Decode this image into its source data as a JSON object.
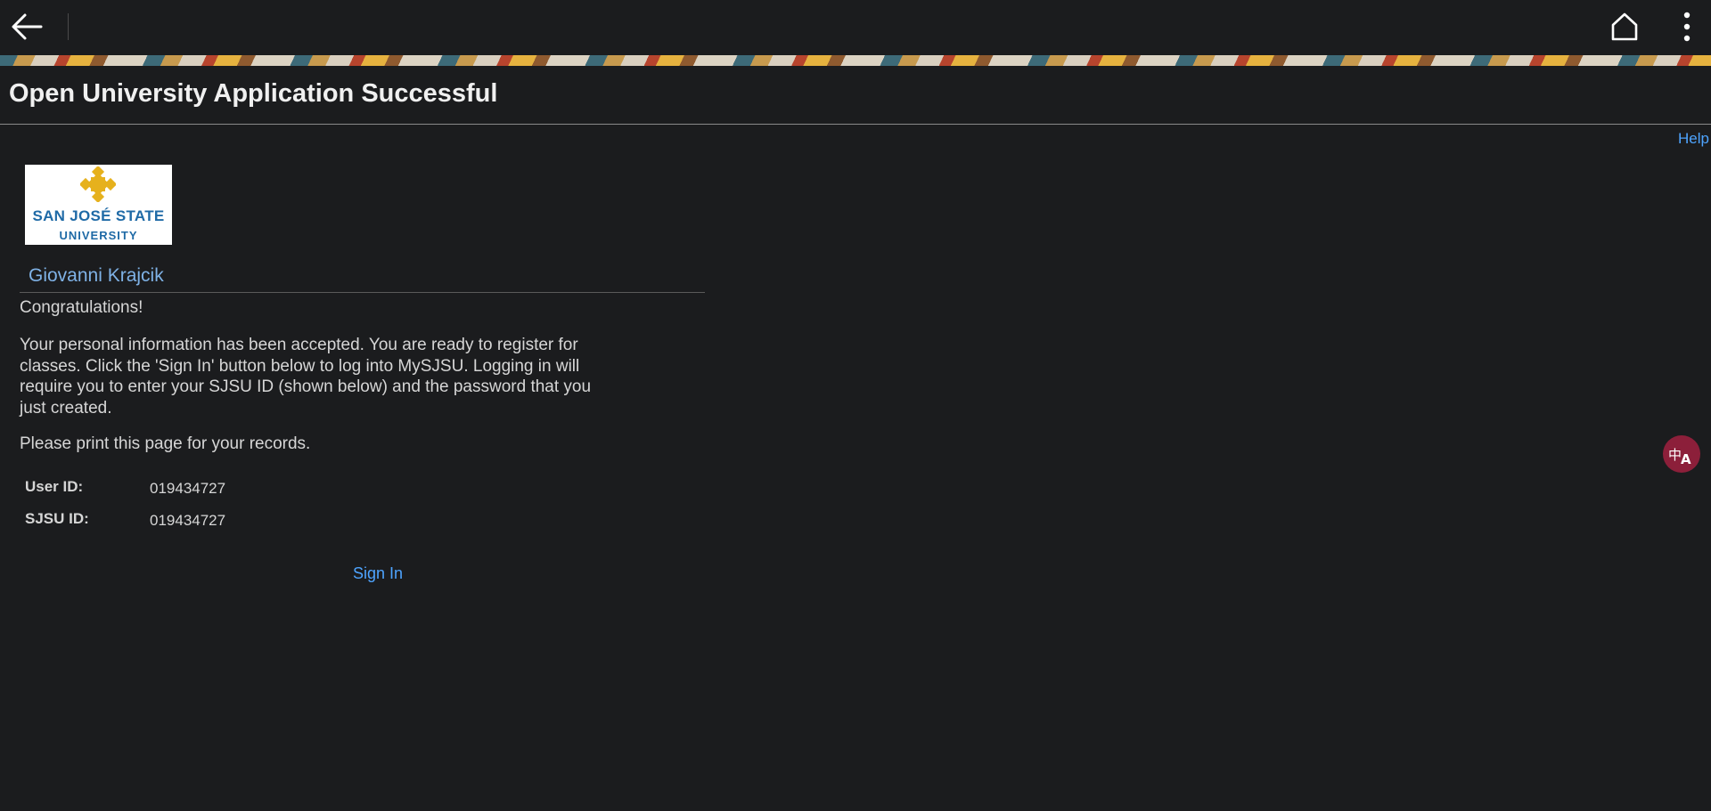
{
  "toolbar": {
    "back_icon": "back-arrow-icon",
    "home_icon": "home-icon",
    "menu_icon": "more-vertical-icon"
  },
  "header": {
    "title": "Open University Application Successful",
    "help_link": "Help"
  },
  "logo": {
    "line1": "SAN JOSÉ STATE",
    "line2": "UNIVERSITY",
    "accent_color": "#e6b11d",
    "text_color": "#1f6aa6"
  },
  "main": {
    "user_name": "Giovanni Krajcik",
    "congrats": "Congratulations!",
    "message": "Your personal information has been accepted. You are ready to register for classes. Click the 'Sign In' button below to log into MySJSU. Logging in will require you to enter your SJSU ID (shown below) and the password that you just created.",
    "print_note": "Please print this page for your records.",
    "fields": [
      {
        "label": "User ID:",
        "value": "019434727"
      },
      {
        "label": "SJSU ID:",
        "value": "019434727"
      }
    ],
    "signin_label": "Sign In"
  },
  "floating": {
    "translate_icon": "translate-icon",
    "translate_color": "#8c1f3a"
  },
  "colors": {
    "background": "#1b1c1e",
    "link": "#4ea4ff",
    "name": "#7fb2e6"
  }
}
